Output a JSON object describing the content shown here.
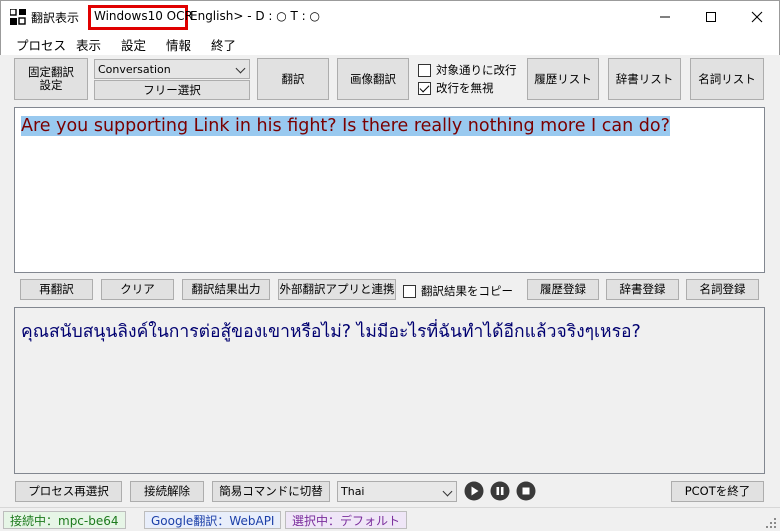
{
  "window": {
    "app_name": "翻訳表示",
    "ocr_engine": "Windows10 OCR",
    "title_rest": "English> - D : ○ T : ○"
  },
  "menu": [
    "プロセス",
    "表示",
    "設定",
    "情報",
    "終了"
  ],
  "toolbar": {
    "fixed_translation": "固定翻訳\n設定",
    "mode_select": "Conversation",
    "free_select": "フリー選択",
    "translate": "翻訳",
    "image_translate": "画像翻訳",
    "linebreak_per_target": "対象通りに改行",
    "ignore_linebreak": "改行を無視",
    "ignore_linebreak_checked": true,
    "linebreak_per_target_checked": false,
    "history_list": "履歴リスト",
    "dictionary_list": "辞書リスト",
    "noun_list": "名詞リスト"
  },
  "source_text": "Are you supporting Link in his fight? Is there really nothing more I can do?",
  "middle_bar": {
    "retranslate": "再翻訳",
    "clear": "クリア",
    "output_result": "翻訳結果出力",
    "external_app": "外部翻訳アプリと連携",
    "copy_result": "翻訳結果をコピー",
    "copy_result_checked": false,
    "register_history": "履歴登録",
    "register_dictionary": "辞書登録",
    "register_noun": "名詞登録"
  },
  "translated_text": "คุณสนับสนุนลิงค์ในการต่อสู้ของเขาหรือไม่? ไม่มีอะไรที่ฉันทำได้อีกแล้วจริงๆเหรอ?",
  "bottom_bar": {
    "reselect_process": "プロセス再選択",
    "disconnect": "接続解除",
    "simple_command": "簡易コマンドに切替",
    "language": "Thai",
    "exit": "PCOTを終了"
  },
  "status": {
    "connection": "接続中：mpc-be64",
    "translator": "Google翻訳：WebAPI",
    "selection": "選択中：デフォルト",
    "connection_color": "#e6f5e6",
    "translator_color": "#e8eefb",
    "selection_color": "#efe6f7"
  }
}
